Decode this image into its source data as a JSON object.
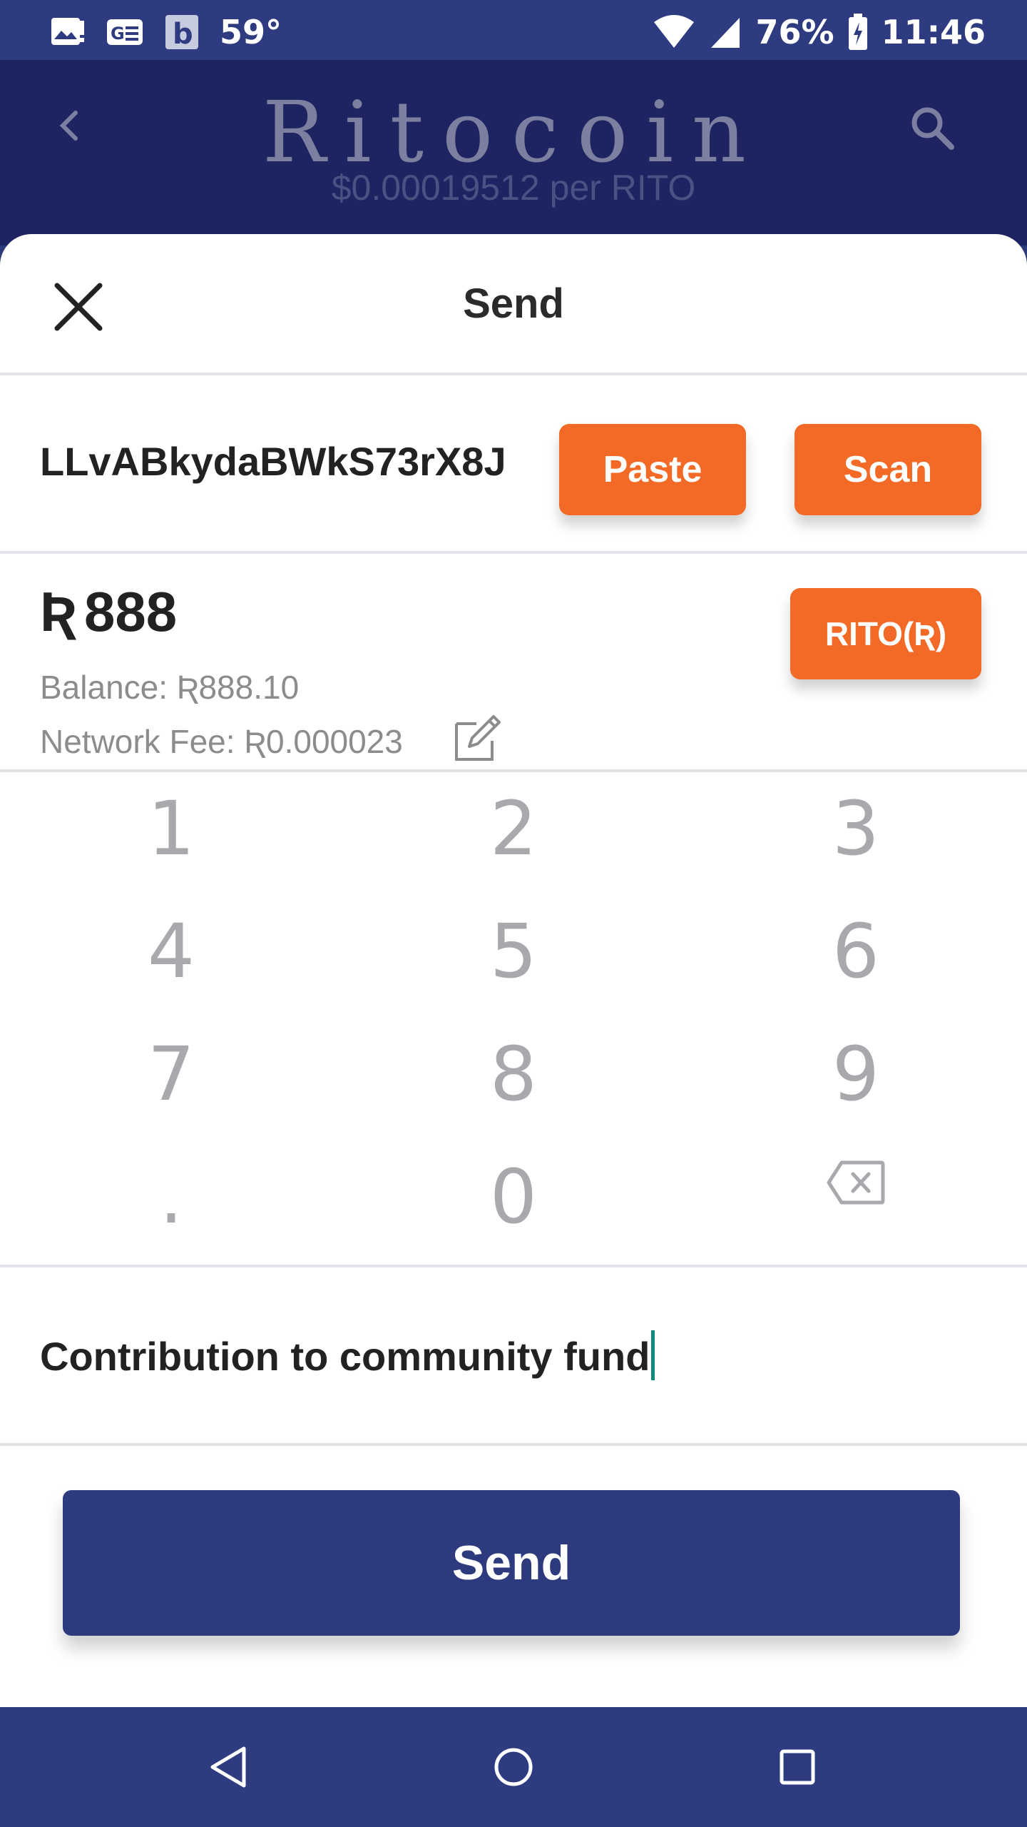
{
  "status_bar": {
    "temperature": "59°",
    "battery": "76%",
    "time": "11:46"
  },
  "header": {
    "title": "Ritocoin",
    "price": "$0.00019512 per RITO"
  },
  "sheet": {
    "title": "Send",
    "address": "LLvABkydaBWkS73rX8J",
    "paste_label": "Paste",
    "scan_label": "Scan",
    "currency_symbol": "Ʀ",
    "amount": "888",
    "currency_button": "RITO(Ʀ)",
    "balance": "Balance: Ʀ888.10",
    "network_fee": "Network Fee: Ʀ0.000023",
    "memo": "Contribution to community fund",
    "send_label": "Send"
  },
  "keypad": {
    "keys": [
      "1",
      "2",
      "3",
      "4",
      "5",
      "6",
      "7",
      "8",
      "9",
      ".",
      "0"
    ]
  },
  "colors": {
    "accent_orange": "#f26a25",
    "primary_navy": "#2e3a7e",
    "header_navy": "#1d2461"
  }
}
